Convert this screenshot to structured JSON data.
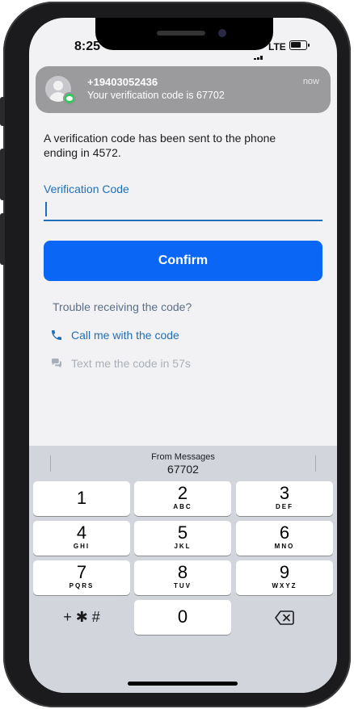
{
  "status_bar": {
    "time": "8:25",
    "network": "LTE"
  },
  "notification": {
    "sender": "+19403052436",
    "message": "Your verification code is 67702",
    "time": "now",
    "icon": "messages-app-icon"
  },
  "main": {
    "info_text": "A verification code has been sent to the phone ending in 4572.",
    "field_label": "Verification Code",
    "field_value": "",
    "confirm_label": "Confirm",
    "trouble_text": "Trouble receiving the code?",
    "call_label": "Call me with the code",
    "text_label": "Text me the code in 57s"
  },
  "keyboard": {
    "suggestion_source": "From Messages",
    "suggestion_code": "67702",
    "keys": [
      {
        "num": "1",
        "letters": ""
      },
      {
        "num": "2",
        "letters": "ABC"
      },
      {
        "num": "3",
        "letters": "DEF"
      },
      {
        "num": "4",
        "letters": "GHI"
      },
      {
        "num": "5",
        "letters": "JKL"
      },
      {
        "num": "6",
        "letters": "MNO"
      },
      {
        "num": "7",
        "letters": "PQRS"
      },
      {
        "num": "8",
        "letters": "TUV"
      },
      {
        "num": "9",
        "letters": "WXYZ"
      },
      {
        "num": "0",
        "letters": ""
      }
    ],
    "symbols_label": "+ ✱ #",
    "delete_icon": "backspace-icon"
  },
  "colors": {
    "accent": "#0a66f5",
    "link": "#1f6fb8",
    "muted": "#a9afb9",
    "keyboard_bg": "#d2d5db"
  }
}
